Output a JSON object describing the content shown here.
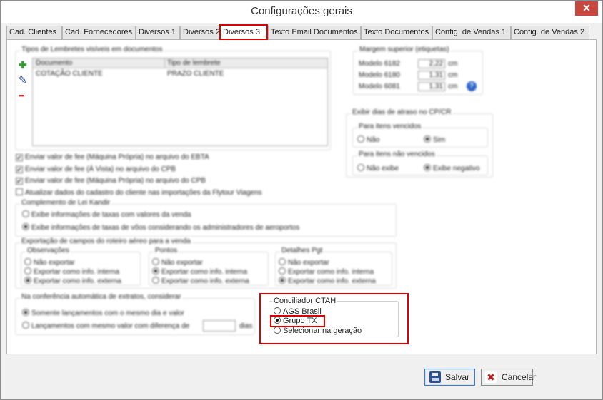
{
  "window": {
    "title": "Configurações gerais",
    "close_glyph": "✕"
  },
  "tabs": [
    {
      "label": "Cad. Clientes"
    },
    {
      "label": "Cad. Fornecedores"
    },
    {
      "label": "Diversos 1"
    },
    {
      "label": "Diversos 2"
    },
    {
      "label": "Diversos 3"
    },
    {
      "label": "Texto Email Documentos"
    },
    {
      "label": "Texto Documentos"
    },
    {
      "label": "Config. de Vendas 1"
    },
    {
      "label": "Config. de Vendas 2"
    }
  ],
  "reminders": {
    "group_label": "Tipos de Lembretes visíveis em documentos",
    "columns": [
      "Documento",
      "Tipo de lembrete"
    ],
    "rows": [
      [
        "COTAÇÃO CLIENTE",
        "PRAZO CLIENTE"
      ]
    ],
    "add_glyph": "✚",
    "edit_glyph": "✎",
    "remove_glyph": "━"
  },
  "checkboxes": [
    {
      "label": "Enviar valor de fee (Máquina Própria) no arquivo do EBTA",
      "checked": true
    },
    {
      "label": "Enviar valor de fee (À Vista) no arquivo do CPB",
      "checked": true
    },
    {
      "label": "Enviar valor de fee (Máquina Própria) no arquivo do CPB",
      "checked": true
    },
    {
      "label": "Atualizar dados do cadastro do cliente nas importações da Flytour Viagens",
      "checked": false
    }
  ],
  "check_glyph": "✔",
  "lei_kandir": {
    "group_label": "Complemento de Lei Kandir",
    "options": [
      {
        "label": "Exibe informações de taxas com valores da venda",
        "selected": false
      },
      {
        "label": "Exibe informações de taxas de vôos considerando os administradores de aeroportos",
        "selected": true
      }
    ]
  },
  "export_fields": {
    "group_label": "Exportação de campos do roteiro aéreo para a venda",
    "sub_groups": [
      {
        "label": "Observações",
        "options": [
          {
            "label": "Não exportar",
            "selected": false
          },
          {
            "label": "Exportar como info. interna",
            "selected": false
          },
          {
            "label": "Exportar como info. externa",
            "selected": true
          }
        ]
      },
      {
        "label": "Pontos",
        "options": [
          {
            "label": "Não exportar",
            "selected": false
          },
          {
            "label": "Exportar como info. interna",
            "selected": true
          },
          {
            "label": "Exportar como info. externa",
            "selected": false
          }
        ]
      },
      {
        "label": "Detalhes Pgt",
        "options": [
          {
            "label": "Não exportar",
            "selected": false
          },
          {
            "label": "Exportar como info. interna",
            "selected": false
          },
          {
            "label": "Exportar como info. externa",
            "selected": true
          }
        ]
      }
    ]
  },
  "reconciliation": {
    "group_label": "Na conferência automática de extratos, considerar",
    "options": [
      {
        "label": "Somente lançamentos com o mesmo dia e valor",
        "selected": true
      },
      {
        "label": "Lançamentos com mesmo valor com diferença de",
        "selected": false
      }
    ],
    "days_value": "",
    "days_unit": "dias"
  },
  "margins": {
    "group_label": "Margem superior (etiquetas)",
    "rows": [
      {
        "label": "Modelo 6182",
        "value": "2,22",
        "unit": "cm"
      },
      {
        "label": "Modelo 6180",
        "value": "1,31",
        "unit": "cm"
      },
      {
        "label": "Modelo 6081",
        "value": "1,31",
        "unit": "cm"
      }
    ],
    "help_glyph": "?"
  },
  "overdue": {
    "group_label": "Exibir dias de atraso no CP/CR",
    "due": {
      "label": "Para itens vencidos",
      "options": [
        {
          "label": "Não",
          "selected": false
        },
        {
          "label": "Sim",
          "selected": true
        }
      ]
    },
    "not_due": {
      "label": "Para itens não vencidos",
      "options": [
        {
          "label": "Não exibe",
          "selected": false
        },
        {
          "label": "Exibe negativo",
          "selected": true
        }
      ]
    }
  },
  "ctah": {
    "group_label": "Conciliador CTAH",
    "options": [
      {
        "label": "AGS Brasil",
        "selected": false
      },
      {
        "label": "Grupo TX",
        "selected": true
      },
      {
        "label": "Selecionar na geração",
        "selected": false
      }
    ]
  },
  "footer": {
    "save_label": "Salvar",
    "cancel_label": "Cancelar",
    "cancel_glyph": "✖"
  },
  "colors": {
    "highlight": "#e00000",
    "add": "#2e9e2e",
    "remove": "#d62020",
    "save_icon": "#2b4f9e",
    "cancel_icon": "#c01818"
  }
}
